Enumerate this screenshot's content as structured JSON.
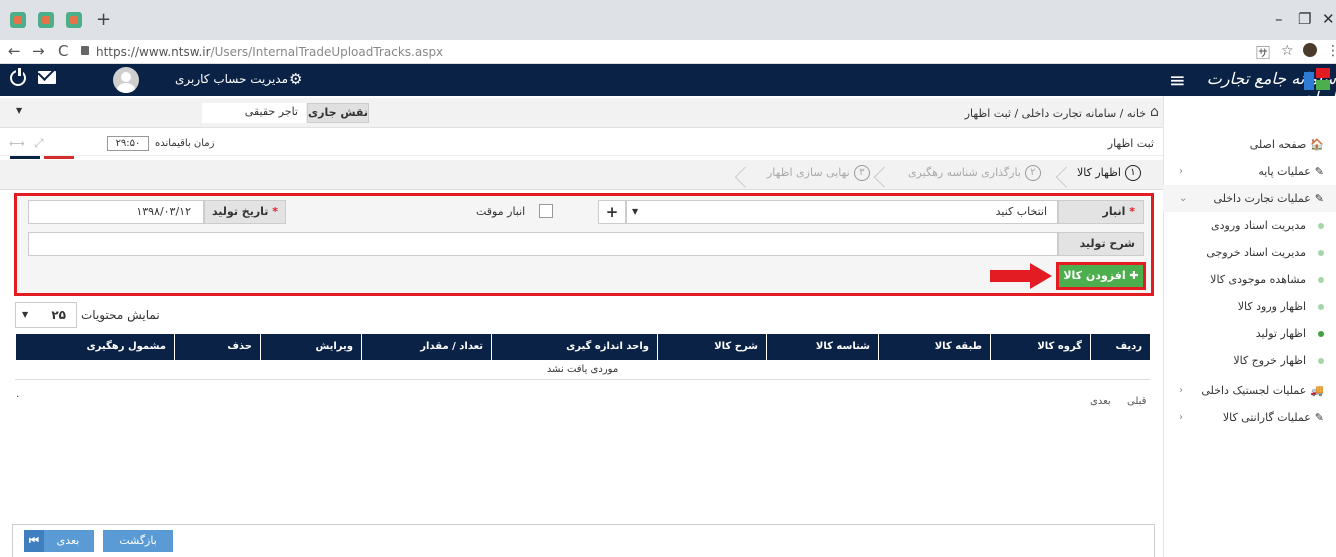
{
  "browser": {
    "new_tab": "+",
    "url_host": "https://www.ntsw.ir",
    "url_path": "/Users/InternalTradeUploadTracks.aspx",
    "win_min": "–",
    "win_max": "❐",
    "win_close": "✕",
    "back": "←",
    "forward": "→",
    "reload": "C",
    "star": "☆",
    "menu": "⋮",
    "translate": "🈂"
  },
  "header": {
    "logo_text": "سامانه جامع تجارت ایران",
    "menu_icon": "≡",
    "account_label": "مدیریت حساب کاربری",
    "gear_icon": "⚙",
    "colors": {
      "navy": "#0b2247",
      "red": "#e31b23",
      "green": "#4cae4c"
    }
  },
  "breadcrumb": {
    "home_icon": "⌂",
    "text": "خانه  /  سامانه تجارت داخلی /  ثبت اظهار"
  },
  "role": {
    "label": "نقش جاری",
    "value": "تاجر حقیقی",
    "caret": "▼"
  },
  "page": {
    "title": "ثبت اظهار",
    "timer_label": "زمان باقیمانده",
    "timer_value": "۲۹:۵۰"
  },
  "steps": [
    {
      "num": "۱",
      "label": "اظهار کالا"
    },
    {
      "num": "۲",
      "label": "بارگذاری شناسه رهگیری"
    },
    {
      "num": "۳",
      "label": "نهایی سازی اظهار"
    }
  ],
  "form": {
    "warehouse_label": "انبار",
    "warehouse_value": "انتخاب کنید",
    "warehouse_caret": "▼",
    "add_icon": "+",
    "temp_warehouse_label": "انبار موقت",
    "date_label": "تاریخ تولید",
    "date_value": "۱۳۹۸/۰۳/۱۲",
    "description_label": "شرح تولید",
    "required_mark": "*",
    "add_goods_button": "✚ افزودن کالا"
  },
  "table": {
    "show_label": "نمایش محتویات",
    "page_size": "۲۵",
    "caret": "▼",
    "columns": [
      "ردیف",
      "گروه کالا",
      "طبقه کالا",
      "شناسه کالا",
      "شرح کالا",
      "واحد اندازه گیری",
      "تعداد / مقدار",
      "ویرایش",
      "حذف",
      "مشمول رهگیری"
    ],
    "empty_text": "موردی یافت نشد",
    "info": "۰",
    "prev": "قبلی",
    "next": "بعدی"
  },
  "footer": {
    "back_button": "بازگشت",
    "next_button": "بعدی",
    "next_tail": "⏮"
  },
  "sidebar": {
    "items": [
      {
        "icon": "🏠",
        "label": "صفحه اصلی",
        "arrow": ""
      },
      {
        "icon": "✎",
        "label": "عملیات پایه",
        "arrow": "‹"
      },
      {
        "icon": "✎",
        "label": "عملیات تجارت داخلی",
        "arrow": "⌄"
      }
    ],
    "subitems": [
      "مدیریت اسناد ورودی",
      "مدیریت اسناد خروجی",
      "مشاهده موجودی کالا",
      "اظهار ورود کالا",
      "اظهار تولید",
      "اظهار خروج کالا"
    ],
    "bottom_items": [
      {
        "icon": "🚚",
        "label": "عملیات لجستیک داخلی",
        "arrow": "‹"
      },
      {
        "icon": "✎",
        "label": "عملیات گارانتی کالا",
        "arrow": "‹"
      }
    ]
  }
}
